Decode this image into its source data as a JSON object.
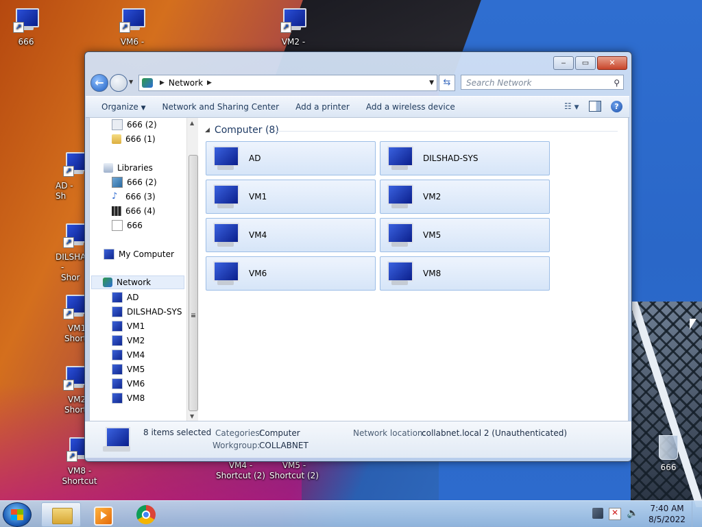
{
  "desktop": {
    "icons": [
      {
        "label": "666"
      },
      {
        "label": "VM6 -"
      },
      {
        "label": "VM2 -"
      },
      {
        "label": "AD - Sh"
      },
      {
        "label": "DILSHA"
      },
      {
        "label": "- Shor"
      },
      {
        "label": "VM1"
      },
      {
        "label": "Short"
      },
      {
        "label": "VM2"
      },
      {
        "label": "Short"
      },
      {
        "label": "VM8 -"
      },
      {
        "label": "Shortcut"
      },
      {
        "label": "VM4 -"
      },
      {
        "label": "Shortcut (2)"
      },
      {
        "label": "VM5 -"
      },
      {
        "label": "Shortcut (2)"
      }
    ],
    "recycle_label": "666"
  },
  "window": {
    "address": {
      "location": "Network"
    },
    "search": {
      "placeholder": "Search Network"
    },
    "toolbar": {
      "organize": "Organize",
      "sharing_center": "Network and Sharing Center",
      "add_printer": "Add a printer",
      "add_wireless": "Add a wireless device"
    },
    "caption": {
      "minimize": "‒",
      "maximize": "▭",
      "close": "✕"
    },
    "navpane": {
      "items": [
        {
          "label": "666 (2)"
        },
        {
          "label": "666 (1)"
        },
        {
          "label": "Libraries"
        },
        {
          "label": "666 (2)"
        },
        {
          "label": "666 (3)"
        },
        {
          "label": "666 (4)"
        },
        {
          "label": "666"
        },
        {
          "label": "My Computer"
        },
        {
          "label": "Network"
        },
        {
          "label": "AD"
        },
        {
          "label": "DILSHAD-SYS"
        },
        {
          "label": "VM1"
        },
        {
          "label": "VM2"
        },
        {
          "label": "VM4"
        },
        {
          "label": "VM5"
        },
        {
          "label": "VM6"
        },
        {
          "label": "VM8"
        }
      ]
    },
    "main": {
      "group_title": "Computer (8)",
      "computers": [
        "AD",
        "DILSHAD-SYS",
        "VM1",
        "VM2",
        "VM4",
        "VM5",
        "VM6",
        "VM8"
      ]
    },
    "details": {
      "selected": "8 items selected",
      "categories_label": "Categories:",
      "categories_value": "Computer",
      "workgroup_label": "Workgroup:",
      "workgroup_value": "COLLABNET",
      "location_label": "Network location:",
      "location_value": "collabnet.local  2 (Unauthenticated)"
    }
  },
  "taskbar": {
    "time": "7:40 AM",
    "date": "8/5/2022"
  }
}
